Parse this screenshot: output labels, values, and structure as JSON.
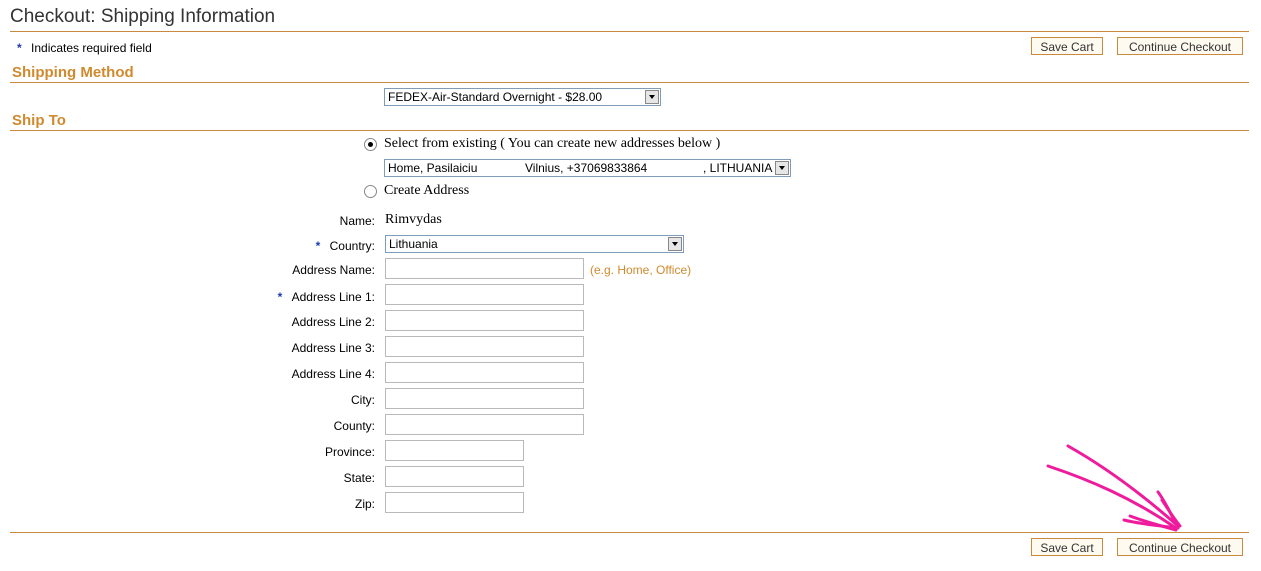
{
  "page": {
    "title": "Checkout: Shipping Information",
    "required_note": "Indicates required field"
  },
  "buttons": {
    "save_cart": "Save Cart",
    "continue_checkout": "Continue Checkout"
  },
  "shipping_method": {
    "heading": "Shipping Method",
    "selected": "FEDEX-Air-Standard Overnight - $28.00"
  },
  "ship_to": {
    "heading": "Ship To",
    "select_existing_label": "Select from existing ( You can create new addresses below )",
    "existing_address_name": "Home, Pasilaiciu",
    "existing_address_city": "Vilnius, +37069833864",
    "existing_address_country": ", LITHUANIA",
    "create_address_label": "Create Address"
  },
  "form": {
    "name_label": "Name:",
    "name_value": "Rimvydas",
    "country_label": "Country:",
    "country_value": "Lithuania",
    "address_name_label": "Address Name:",
    "address_name_hint": "(e.g. Home, Office)",
    "address_line1_label": "Address Line 1:",
    "address_line2_label": "Address Line 2:",
    "address_line3_label": "Address Line 3:",
    "address_line4_label": "Address Line 4:",
    "city_label": "City:",
    "county_label": "County:",
    "province_label": "Province:",
    "state_label": "State:",
    "zip_label": "Zip:"
  },
  "required_marker": "*",
  "colors": {
    "accent": "#d08a2e",
    "rule": "#c98a3e",
    "required_star": "#1a3bb0",
    "annotation": "#ee1c9c"
  }
}
